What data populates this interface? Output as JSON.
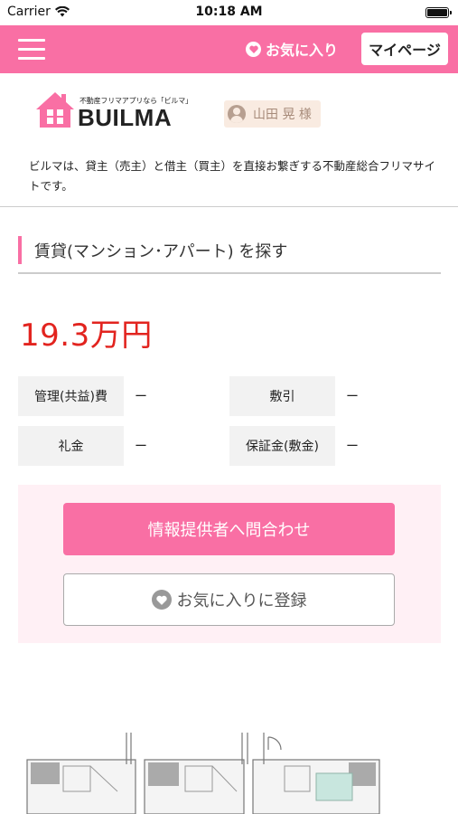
{
  "status_bar": {
    "carrier": "Carrier",
    "time": "10:18 AM"
  },
  "navbar": {
    "favorites_label": "お気に入り",
    "mypage_label": "マイページ"
  },
  "header": {
    "logo_tagline": "不動産フリマアプリなら「ビルマ」",
    "logo_word": "BUILMA",
    "user_name": "山田 晃 様",
    "tagline": "ビルマは、貸主（売主）と借主（買主）を直接お繋ぎする不動産総合フリマサイトです。"
  },
  "listing": {
    "section_title": "賃貸(マンション･アパート) を探す",
    "price": "19.3万円",
    "fees": [
      {
        "label": "管理(共益)費",
        "value": "ー"
      },
      {
        "label": "敷引",
        "value": "ー"
      },
      {
        "label": "礼金",
        "value": "ー"
      },
      {
        "label": "保証金(敷金)",
        "value": "ー"
      }
    ]
  },
  "actions": {
    "inquire_label": "情報提供者へ問合わせ",
    "favorite_label": "お気に入りに登録"
  },
  "colors": {
    "brand_pink": "#f96fa4",
    "price_red": "#e2241f",
    "contact_bg": "#fff0f5",
    "user_badge_bg": "#f9ebe1"
  },
  "icons": [
    "wifi-icon",
    "battery-icon",
    "menu-icon",
    "heart-icon",
    "user-icon",
    "house-logo-icon"
  ]
}
